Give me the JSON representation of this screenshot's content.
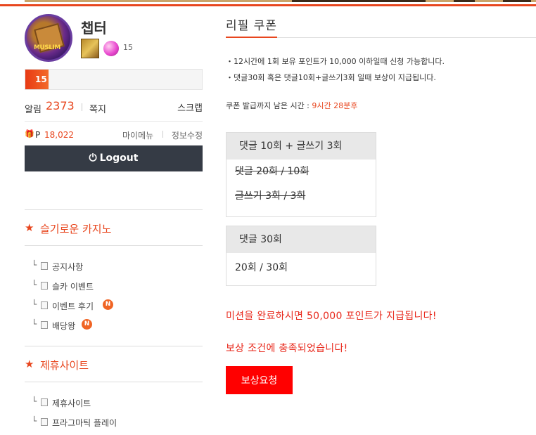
{
  "profile": {
    "nickname": "챕터",
    "avatar_text": "MUSLIM",
    "gem_count": "15",
    "level": "15",
    "xp_fraction": 0.13
  },
  "stats": {
    "alarm_label": "알림",
    "alarm_count": "2373",
    "message_label": "쪽지",
    "scrap_label": "스크랩",
    "point_label": "P",
    "point_value": "18,022",
    "my_menu": "마이메뉴",
    "edit_info": "정보수정"
  },
  "logout_label": "Logout",
  "sections": [
    {
      "title": "슬기로운 카지노",
      "items": [
        {
          "label": "공지사항",
          "badge": ""
        },
        {
          "label": "슬카 이벤트",
          "badge": ""
        },
        {
          "label": "이벤트 후기",
          "badge": "N"
        },
        {
          "label": "배당왕",
          "badge": "N"
        }
      ]
    },
    {
      "title": "제휴사이트",
      "items": [
        {
          "label": "제휴사이트",
          "badge": ""
        },
        {
          "label": "프라그마틱 플레이",
          "badge": ""
        }
      ]
    }
  ],
  "main": {
    "tab_title": "리필 쿠폰",
    "notes": [
      "・12시간에 1회 보유 포인트가 10,000 이하일때 신청 가능합니다.",
      "・댓글30회 혹은 댓글10회+글쓰기3회 일때 보상이 지급됩니다."
    ],
    "timer_label": "쿠폰 발급까지 남은 시간 : ",
    "timer_value": "9시간 28분후",
    "box1": {
      "header": "댓글 10회 + 글쓰기 3회",
      "line1": "댓글 20회 / 10회",
      "line2": "글쓰기 3회 / 3회"
    },
    "box2": {
      "header": "댓글 30회",
      "line1": "20회 / 30회"
    },
    "mission_text": "미션을 완료하시면 50,000 포인트가 지급됩니다!",
    "reward_text": "보상 조건에 충족되었습니다!",
    "request_button": "보상요청"
  },
  "colors": {
    "accent": "#e8461e",
    "reward_red": "#e8291c",
    "button_red": "#ff0000",
    "logout_bg": "#353b45"
  }
}
